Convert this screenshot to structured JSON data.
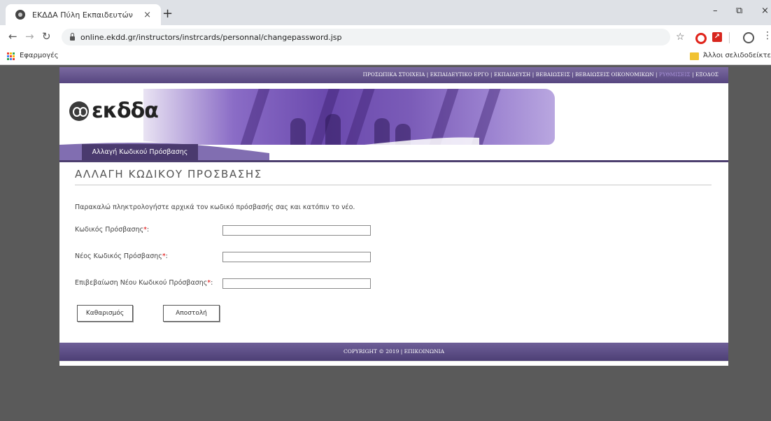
{
  "browser": {
    "tab_title": "ΕΚΔΔΑ Πύλη Εκπαιδευτών",
    "tab_close": "×",
    "new_tab": "+",
    "url": "online.ekdd.gr/instructors/instrcards/personnal/changepassword.jsp",
    "bookmarks": {
      "apps_label": "Εφαρμογές",
      "other_label": "Άλλοι σελιδοδείκτες"
    },
    "window_controls": [
      "–",
      "⧉",
      "×"
    ]
  },
  "site": {
    "nav": {
      "items": [
        {
          "label": "ΠΡΟΣΩΠΙΚΑ ΣΤΟΙΧΕΙΑ"
        },
        {
          "label": "ΕΚΠΑΙΔΕΥΤΙΚΟ ΕΡΓΟ"
        },
        {
          "label": "ΕΚΠΑΙΔΕΥΣΗ"
        },
        {
          "label": "ΒΕΒΑΙΩΣΕΙΣ"
        },
        {
          "label": "ΒΕΒΑΙΩΣΕΙΣ ΟΙΚΟΝΟΜΙΚΩΝ"
        },
        {
          "label": "ΡΥΘΜΙΣΕΙΣ"
        },
        {
          "label": "ΕΞΟΔΟΣ"
        }
      ],
      "separator": " | ",
      "active_index": 5,
      "active_color": "#a891d8"
    },
    "logo_text": "εκδδα",
    "banner_tab": "Αλλαγή Κωδικού Πρόσβασης",
    "page_title": "ΑΛΛΑΓΗ ΚΩΔΙΚΟΥ ΠΡΟΣΒΑΣΗΣ",
    "intro": "Παρακαλώ πληκτρολογήστε αρχικά τον κωδικό πρόσβασής σας και κατόπιν το νέο.",
    "form": {
      "required_marker": "*",
      "colon": ":",
      "fields": [
        {
          "label": "Κωδικός Πρόσβασης",
          "value": ""
        },
        {
          "label": "Νέος Κωδικός Πρόσβασης",
          "value": ""
        },
        {
          "label": "Επιβεβαίωση Νέου Κωδικού Πρόσβασης",
          "value": ""
        }
      ],
      "clear_button": "Καθαρισμός",
      "submit_button": "Αποστολή"
    },
    "footer": "COPYRIGHT © 2019 | ΕΠΙΚΟΙΝΩΝΙΑ"
  },
  "colors": {
    "brand_purple": "#574680",
    "page_background": "#5a5a5a",
    "required": "#dd0000"
  }
}
